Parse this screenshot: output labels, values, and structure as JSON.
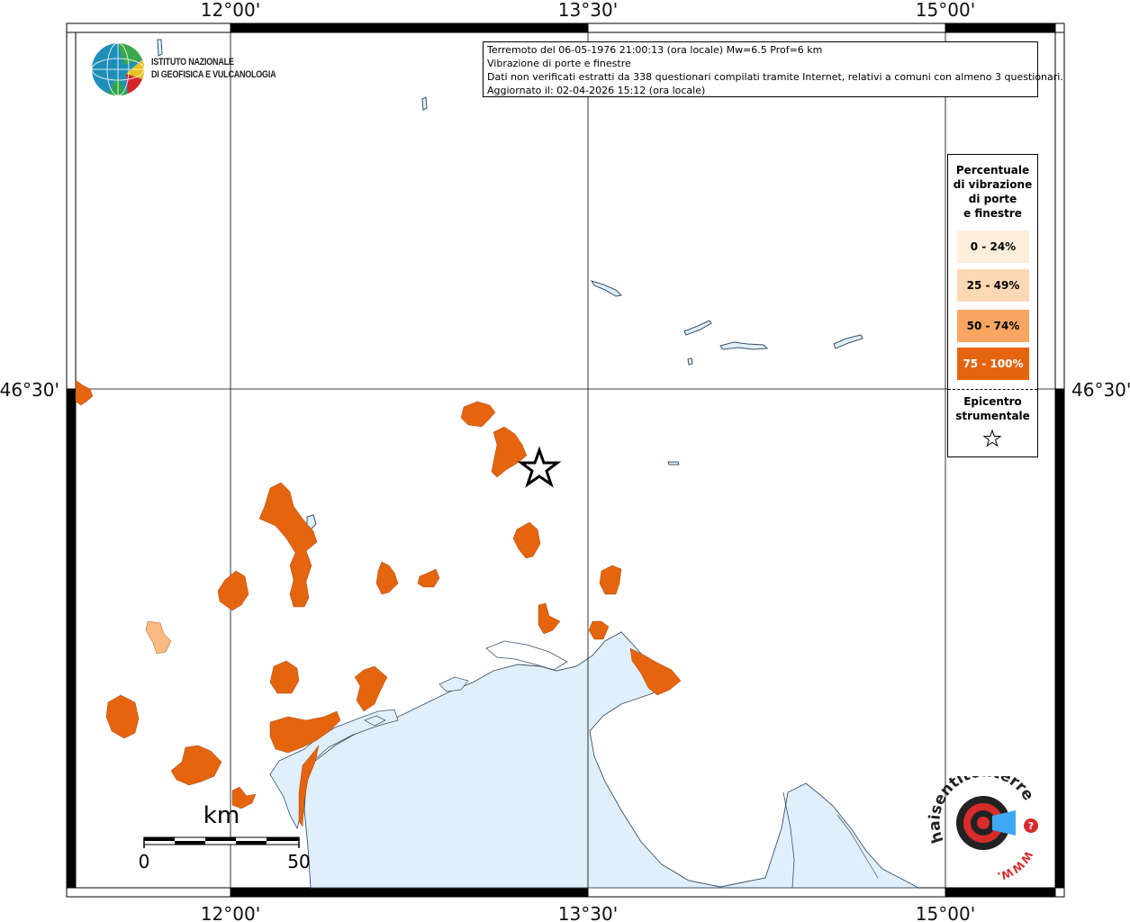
{
  "map": {
    "lon_labels": [
      "12°00'",
      "13°30'",
      "15°00'"
    ],
    "lat_labels": [
      "46°30'"
    ],
    "scale": {
      "unit": "km",
      "start": "0",
      "end": "50"
    }
  },
  "info": {
    "line1": "Terremoto del 06-05-1976 21:00:13 (ora locale) Mw=6.5 Prof=6 km",
    "line2": "Vibrazione di porte e finestre",
    "line3": "Dati non verificati estratti da 338 questionari compilati tramite Internet, relativi a comuni con almeno 3 questionari.",
    "line4": "Aggiornato il: 02-04-2026 15:12 (ora locale)"
  },
  "logo": {
    "line1": "ISTITUTO NAZIONALE",
    "line2": "DI GEOFISICA E VULCANOLOGIA"
  },
  "legend": {
    "title": [
      "Percentuale",
      "di vibrazione",
      "di porte",
      "e finestre"
    ],
    "classes": [
      {
        "label": "0 - 24%",
        "color": "#fdeedb",
        "text_color": "#000000"
      },
      {
        "label": "25 - 49%",
        "color": "#fcd8b4",
        "text_color": "#000000"
      },
      {
        "label": "50 - 74%",
        "color": "#f9a662",
        "text_color": "#000000"
      },
      {
        "label": "75 - 100%",
        "color": "#e5640e",
        "text_color": "#ffffff"
      }
    ],
    "epicenter_label": [
      "Epicentro",
      "strumentale"
    ]
  },
  "colors": {
    "sea": "#e0f0fb",
    "coast": "#3a5066",
    "high": "#e5640e",
    "low": "#f9bb82"
  },
  "badge": {
    "text": "haisentitoilterremoto.it",
    "url": "WWW.",
    "brand_color": "#d92b2b"
  }
}
